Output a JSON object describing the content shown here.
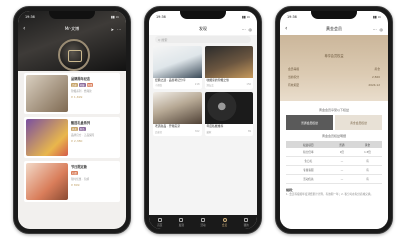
{
  "status": {
    "time": "19:36"
  },
  "phone1": {
    "title": "Mr·文博",
    "items": [
      {
        "title": "品牌周年纪念",
        "chips": [
          "品鉴",
          "收藏",
          "限量"
        ],
        "sub": "珍藏系列 · 经典款",
        "price": "¥ 1,699"
      },
      {
        "title": "甄选礼盒系列",
        "chips": [
          "热卖",
          "新品"
        ],
        "sub": "品牌官方 · 正品保障",
        "price": "¥ 2,380"
      },
      {
        "title": "节日限定款",
        "chips": [
          "礼赠"
        ],
        "sub": "限时优惠 · 包邮",
        "price": "¥ 899"
      }
    ],
    "colors": {
      "accent": "#c2a36b",
      "chip_a": "#c7a46a",
      "chip_b": "#8b6b9c",
      "chip_c": "#d97d5a"
    }
  },
  "phone2": {
    "title": "发现",
    "search_placeholder": "Q 搜索",
    "cards": [
      {
        "caption": "经典之选 · 品鉴笔记分享",
        "likes": "218",
        "author": "小酒馆"
      },
      {
        "caption": "收藏家的珍藏之旅",
        "likes": "156",
        "author": "酒友会"
      },
      {
        "caption": "老酒新品 · 开箱实录",
        "likes": "302",
        "author": "品鉴官"
      },
      {
        "caption": "年度私藏推荐",
        "likes": "89",
        "author": "藏家"
      }
    ],
    "tabs": [
      "首页",
      "发现",
      "活动",
      "会员",
      "我的"
    ],
    "active_tab": 3
  },
  "phone3": {
    "title": "黄金会员",
    "card_title": "尊享会员权益",
    "card_lines": [
      {
        "k": "会员等级",
        "v": "黄金"
      },
      {
        "k": "当前积分",
        "v": "2,560"
      },
      {
        "k": "有效期至",
        "v": "2024.12"
      }
    ],
    "panel_heading": "黄金会员享受以下权益",
    "compare": [
      "普通会员权益",
      "黄金会员权益"
    ],
    "table_heading": "黄金会员权益明细",
    "table": {
      "headers": [
        "权益项目",
        "普通",
        "黄金"
      ],
      "rows": [
        [
          "积分倍率",
          "1倍",
          "1.5倍"
        ],
        [
          "生日礼",
          "—",
          "有"
        ],
        [
          "专属客服",
          "—",
          "有"
        ],
        [
          "活动优先",
          "—",
          "有"
        ]
      ]
    },
    "notes_title": "规则：",
    "notes": "1. 会员等级按年度消费累计计算，有效期一年；2. 积分可在积分商城兑换。"
  }
}
